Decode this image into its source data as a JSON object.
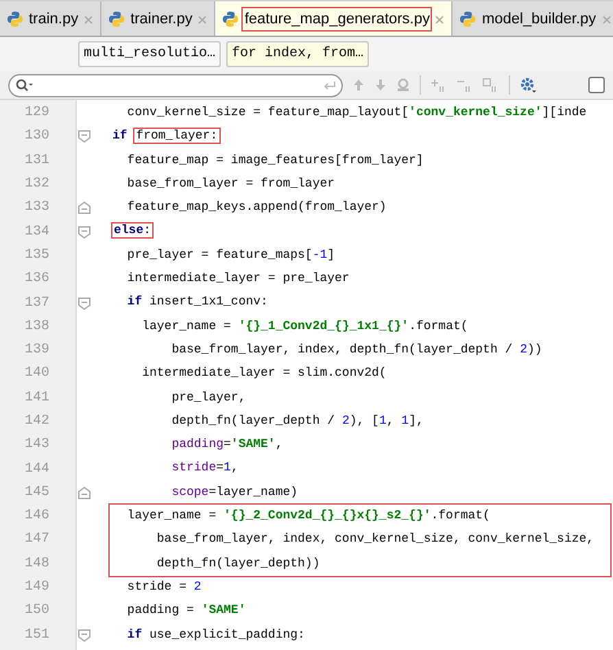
{
  "tabs": [
    {
      "label": "train.py",
      "selected": false,
      "boxed": false
    },
    {
      "label": "trainer.py",
      "selected": false,
      "boxed": false
    },
    {
      "label": "feature_map_generators.py",
      "selected": true,
      "boxed": true
    },
    {
      "label": "model_builder.py",
      "selected": false,
      "boxed": false
    }
  ],
  "breadcrumbs": [
    {
      "label": "multi_resolutio…",
      "selected": false
    },
    {
      "label": "for index, from…",
      "selected": true
    }
  ],
  "search": {
    "match_case": false
  },
  "code": [
    {
      "number": "129",
      "boxed": false,
      "tokens": [
        {
          "kind": "plain",
          "t": "  conv_kernel_size = feature_map_layout["
        },
        {
          "kind": "str",
          "t": "'conv_kernel_size'"
        },
        {
          "kind": "plain",
          "t": "][inde"
        }
      ]
    },
    {
      "number": "130",
      "fold": {
        "kind": "start"
      },
      "boxed": false,
      "tokens": [
        {
          "kind": "kw",
          "t": "if "
        },
        {
          "kind": "plain",
          "t": "from_layer:",
          "boxed": true
        }
      ]
    },
    {
      "number": "131",
      "boxed": false,
      "tokens": [
        {
          "kind": "plain",
          "t": "  feature_map = image_features[from_layer]"
        }
      ]
    },
    {
      "number": "132",
      "boxed": false,
      "tokens": [
        {
          "kind": "plain",
          "t": "  base_from_layer = from_layer"
        }
      ]
    },
    {
      "number": "133",
      "fold": {
        "kind": "end"
      },
      "boxed": false,
      "tokens": [
        {
          "kind": "plain",
          "t": "  feature_map_keys.append(from_layer)"
        }
      ]
    },
    {
      "number": "134",
      "fold": {
        "kind": "start"
      },
      "boxed": false,
      "tokens": [
        {
          "kind": "kw",
          "t": "else",
          "boxed": true
        },
        {
          "kind": "plain",
          "t": ":",
          "boxed": true
        }
      ]
    },
    {
      "number": "135",
      "boxed": false,
      "tokens": [
        {
          "kind": "plain",
          "t": "  pre_layer = feature_maps["
        },
        {
          "kind": "num",
          "t": "-1"
        },
        {
          "kind": "plain",
          "t": "]"
        }
      ]
    },
    {
      "number": "136",
      "boxed": false,
      "tokens": [
        {
          "kind": "plain",
          "t": "  intermediate_layer = pre_layer"
        }
      ]
    },
    {
      "number": "137",
      "fold": {
        "kind": "start"
      },
      "boxed": false,
      "tokens": [
        {
          "kind": "kw",
          "t": "  if"
        },
        {
          "kind": "plain",
          "t": " insert_1x1_conv:"
        }
      ]
    },
    {
      "number": "138",
      "boxed": false,
      "tokens": [
        {
          "kind": "plain",
          "t": "    layer_name = "
        },
        {
          "kind": "str",
          "t": "'{}_1_Conv2d_{}_1x1_{}'"
        },
        {
          "kind": "plain",
          "t": ".format("
        }
      ]
    },
    {
      "number": "139",
      "boxed": false,
      "tokens": [
        {
          "kind": "plain",
          "t": "        base_from_layer, index, depth_fn(layer_depth / "
        },
        {
          "kind": "num",
          "t": "2"
        },
        {
          "kind": "plain",
          "t": "))"
        }
      ]
    },
    {
      "number": "140",
      "boxed": false,
      "tokens": [
        {
          "kind": "plain",
          "t": "    intermediate_layer = slim.conv2d("
        }
      ]
    },
    {
      "number": "141",
      "boxed": false,
      "tokens": [
        {
          "kind": "plain",
          "t": "        pre_layer,"
        }
      ]
    },
    {
      "number": "142",
      "boxed": false,
      "tokens": [
        {
          "kind": "plain",
          "t": "        depth_fn(layer_depth / "
        },
        {
          "kind": "num",
          "t": "2"
        },
        {
          "kind": "plain",
          "t": "), ["
        },
        {
          "kind": "num",
          "t": "1"
        },
        {
          "kind": "plain",
          "t": ", "
        },
        {
          "kind": "num",
          "t": "1"
        },
        {
          "kind": "plain",
          "t": "],"
        }
      ]
    },
    {
      "number": "143",
      "boxed": false,
      "tokens": [
        {
          "kind": "kwarg",
          "t": "        padding"
        },
        {
          "kind": "plain",
          "t": "="
        },
        {
          "kind": "str",
          "t": "'SAME'"
        },
        {
          "kind": "plain",
          "t": ","
        }
      ]
    },
    {
      "number": "144",
      "boxed": false,
      "tokens": [
        {
          "kind": "kwarg",
          "t": "        stride"
        },
        {
          "kind": "plain",
          "t": "="
        },
        {
          "kind": "num",
          "t": "1"
        },
        {
          "kind": "plain",
          "t": ","
        }
      ]
    },
    {
      "number": "145",
      "fold": {
        "kind": "end"
      },
      "boxed": false,
      "tokens": [
        {
          "kind": "kwarg",
          "t": "        scope"
        },
        {
          "kind": "plain",
          "t": "=layer_name)"
        }
      ]
    },
    {
      "number": "146",
      "boxed": true,
      "tokens": [
        {
          "kind": "plain",
          "t": "  layer_name = "
        },
        {
          "kind": "str",
          "t": "'{}_2_Conv2d_{}_{}x{}_s2_{}'"
        },
        {
          "kind": "plain",
          "t": ".format("
        }
      ]
    },
    {
      "number": "147",
      "boxed": true,
      "tokens": [
        {
          "kind": "plain",
          "t": "      base_from_layer, index, conv_kernel_size, conv_kernel_size,"
        }
      ]
    },
    {
      "number": "148",
      "boxed": true,
      "tokens": [
        {
          "kind": "plain",
          "t": "      depth_fn(layer_depth))"
        }
      ]
    },
    {
      "number": "149",
      "boxed": false,
      "tokens": [
        {
          "kind": "plain",
          "t": "  stride = "
        },
        {
          "kind": "num",
          "t": "2"
        }
      ]
    },
    {
      "number": "150",
      "boxed": false,
      "tokens": [
        {
          "kind": "plain",
          "t": "  padding = "
        },
        {
          "kind": "str",
          "t": "'SAME'"
        }
      ]
    },
    {
      "number": "151",
      "fold": {
        "kind": "start"
      },
      "boxed": false,
      "tokens": [
        {
          "kind": "kw",
          "t": "  if"
        },
        {
          "kind": "plain",
          "t": " use_explicit_padding:"
        }
      ]
    }
  ]
}
